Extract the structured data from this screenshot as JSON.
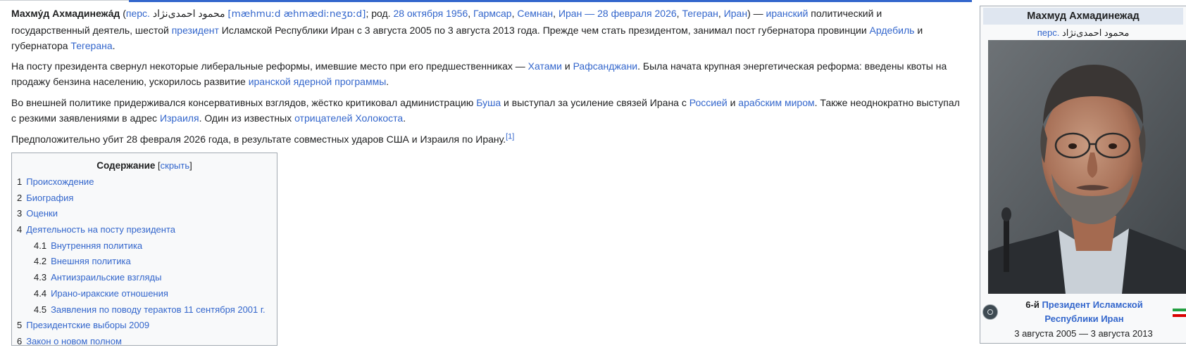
{
  "paragraph1": {
    "name": "Махму́д Ахмадинежа́д",
    "open_paren": " (",
    "lang_abbr": "перс.",
    "persian": " محمود احمدی‌نژاد ",
    "ipa": "[mæhmuːd æhmædiːneʒɒːd]",
    "born_prefix": "; род. ",
    "birth_date": "28 октября 1956",
    "comma1": ", ",
    "birth_place": "Гармсар",
    "comma2": ", ",
    "province": "Семнан",
    "comma3": ", ",
    "country": "Иран",
    "dash": " — ",
    "death_date": "28 февраля 2026",
    "comma4": ", ",
    "death_place": "Тегеран",
    "comma5": ", ",
    "country2": "Иран",
    "close": ") — ",
    "nationality": "иранский",
    "text1": " политический и государственный деятель, шестой ",
    "president_link": "президент",
    "text2": " Исламской Республики Иран с 3 августа 2005 по 3 августа 2013 года. Прежде чем стать президентом, занимал пост губернатора провинции ",
    "ardabil": "Ардебиль",
    "text3": " и губернатора ",
    "tehran": "Тегерана",
    "end": "."
  },
  "paragraph2": {
    "text1": "На посту президента свернул некоторые либеральные реформы, имевшие место при его предшественниках — ",
    "khatami": "Хатами",
    "and": " и ",
    "rafsanjani": "Рафсанджани",
    "text2": ". Была начата крупная энергетическая реформа: введены квоты на продажу бензина населению, ускорилось развитие ",
    "nuclear": "иранской ядерной программы",
    "end": "."
  },
  "paragraph3": {
    "text1": "Во внешней политике придерживался консервативных взглядов, жёстко критиковал администрацию ",
    "bush": "Буша",
    "text2": " и выступал за усиление связей Ирана с ",
    "russia": "Россией",
    "and": " и ",
    "arab": "арабским миром",
    "text3": ". Также неоднократно выступал с резкими заявлениями в адрес ",
    "israel": "Израиля",
    "text4": ". Один из известных ",
    "deniers": "отрицателей Холокоста",
    "end": "."
  },
  "paragraph4": {
    "text": "Предположительно убит 28 февраля 2026 года, в результате совместных ударов США и Израиля по Ирану.",
    "ref": "[1]"
  },
  "toc": {
    "title": "Содержание",
    "toggle_open": " [",
    "toggle_label": "скрыть",
    "toggle_close": "]",
    "items": [
      {
        "num": "1",
        "label": "Происхождение"
      },
      {
        "num": "2",
        "label": "Биография"
      },
      {
        "num": "3",
        "label": "Оценки"
      },
      {
        "num": "4",
        "label": "Деятельность на посту президента"
      },
      {
        "num": "4.1",
        "label": "Внутренняя политика"
      },
      {
        "num": "4.2",
        "label": "Внешняя политика"
      },
      {
        "num": "4.3",
        "label": "Антиизраильские взгляды"
      },
      {
        "num": "4.4",
        "label": "Ирано-иракские отношения"
      },
      {
        "num": "4.5",
        "label": "Заявления по поводу терактов 11 сентября 2001 г."
      },
      {
        "num": "5",
        "label": "Президентские выборы 2009"
      },
      {
        "num": "6",
        "label": "Закон о новом полном"
      }
    ]
  },
  "infobox": {
    "name": "Махмуд Ахмадинежад",
    "lang_abbr": "перс.",
    "native_name": " محمود احمدی‌نژاد",
    "office_ordinal": "6-й ",
    "office_link": "Президент Исламской Республики Иран",
    "term": "3 августа 2005 — 3 августа 2013"
  },
  "colors": {
    "link": "#3366cc",
    "visited_link": "#0645ad",
    "text": "#202122",
    "infobox_bg": "#f8f9fa",
    "infobox_header": "#dfe6f0",
    "border": "#a2a9b1"
  }
}
